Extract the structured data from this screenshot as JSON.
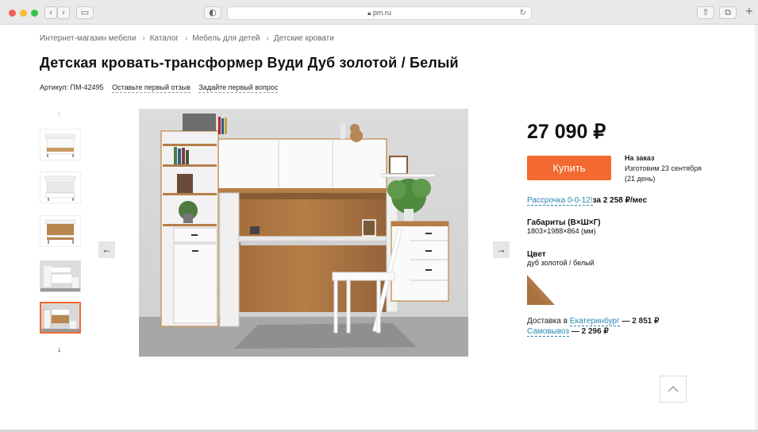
{
  "browser": {
    "url": "pm.ru",
    "lock_icon": "lock-icon",
    "reload_icon": "reload-icon"
  },
  "breadcrumbs": [
    {
      "label": "Интернет-магазин мебели"
    },
    {
      "label": "Каталог"
    },
    {
      "label": "Мебель для детей"
    },
    {
      "label": "Детские кровати"
    }
  ],
  "breadcrumb_separator": "›",
  "product": {
    "title": "Детская кровать-трансформер Вуди Дуб золотой / Белый",
    "sku": "Артикул: ПМ-42495",
    "review_link": "Оставьте первый отзыв",
    "question_link": "Задайте первый вопрос",
    "price": "27 090 ₽",
    "buy_label": "Купить",
    "order_status": "На заказ",
    "order_ready": "Изготовим 23 сентября",
    "order_days": "(21 день)",
    "installment_link": "Рассрочка 0-0-12!",
    "installment_text": "за 2 258 ₽/мес",
    "dimensions_label": "Габариты (В×Ш×Г)",
    "dimensions_value": "1803×1988×864 (мм)",
    "color_label": "Цвет",
    "color_value": "дуб золотой / белый",
    "delivery_prefix": "Доставка в",
    "delivery_city": "Екатеринбург",
    "delivery_price": "— 2 851 ₽",
    "pickup_link": "Самовывоз",
    "pickup_price": "— 2 296 ₽"
  },
  "gallery": {
    "thumbnail_count": 5,
    "selected_index": 4,
    "arrows": {
      "up": "↑",
      "down": "↓",
      "prev": "←",
      "next": "→"
    }
  },
  "colors": {
    "accent": "#f26a30",
    "link": "#2a87b5",
    "oak": "#b07a45",
    "white": "#ffffff"
  }
}
